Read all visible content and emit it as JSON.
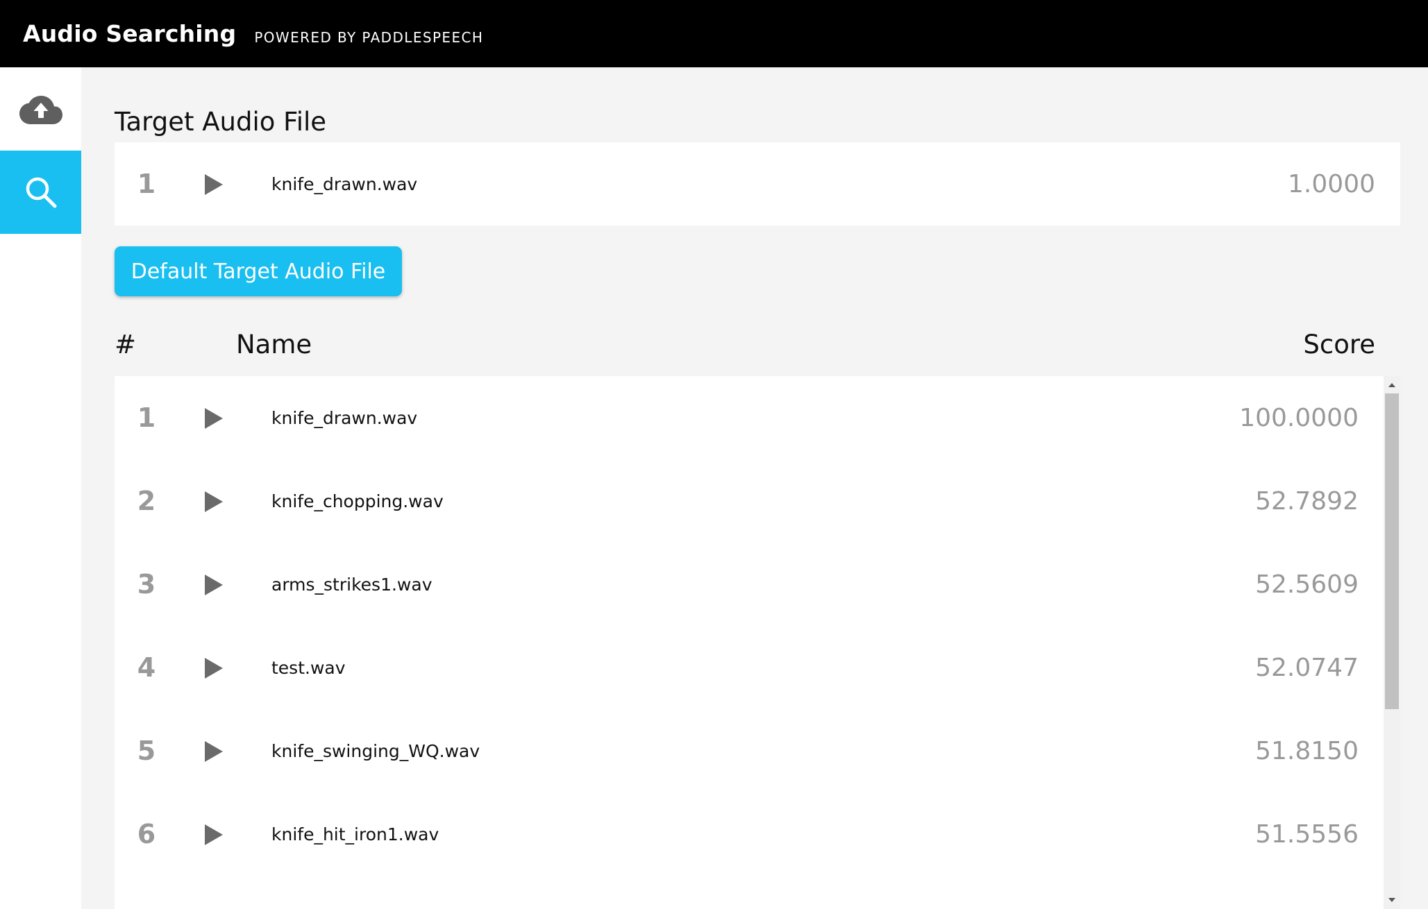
{
  "header": {
    "title": "Audio Searching",
    "subtitle": "POWERED BY PADDLESPEECH"
  },
  "sidebar": {
    "items": [
      {
        "name": "upload",
        "icon": "cloud-upload-icon",
        "active": false
      },
      {
        "name": "search",
        "icon": "search-icon",
        "active": true
      }
    ],
    "accent_color": "#19bff0"
  },
  "target": {
    "title": "Target Audio File",
    "row": {
      "index": "1",
      "name": "knife_drawn.wav",
      "score": "1.0000"
    },
    "default_button_label": "Default Target Audio File"
  },
  "results": {
    "columns": {
      "index": "#",
      "name": "Name",
      "score": "Score"
    },
    "rows": [
      {
        "index": "1",
        "name": "knife_drawn.wav",
        "score": "100.0000"
      },
      {
        "index": "2",
        "name": "knife_chopping.wav",
        "score": "52.7892"
      },
      {
        "index": "3",
        "name": "arms_strikes1.wav",
        "score": "52.5609"
      },
      {
        "index": "4",
        "name": "test.wav",
        "score": "52.0747"
      },
      {
        "index": "5",
        "name": "knife_swinging_WQ.wav",
        "score": "51.8150"
      },
      {
        "index": "6",
        "name": "knife_hit_iron1.wav",
        "score": "51.5556"
      }
    ]
  },
  "icons": {
    "play": "play-icon"
  }
}
